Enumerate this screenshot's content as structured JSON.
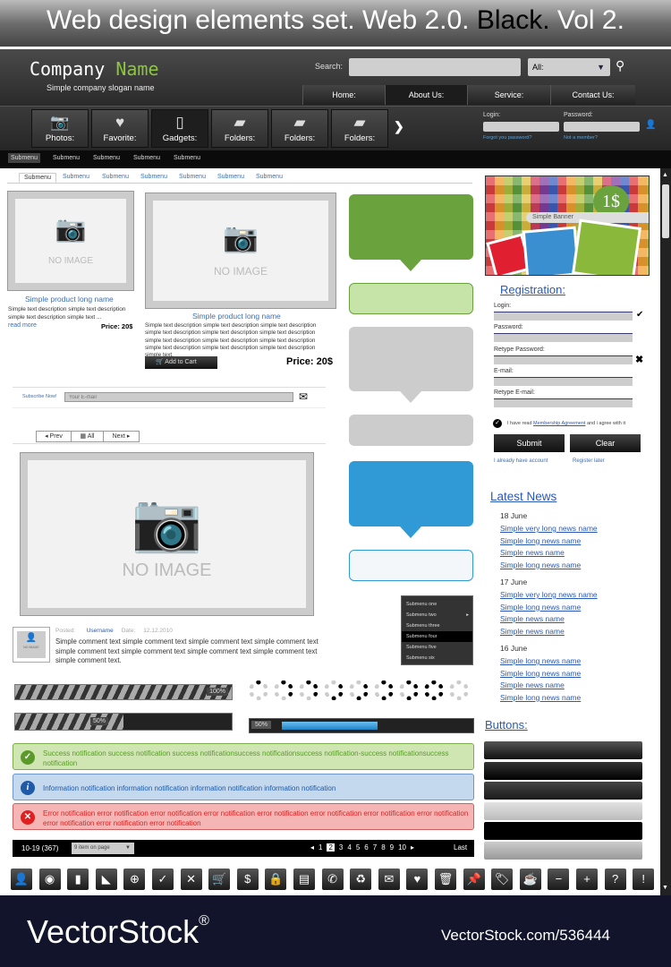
{
  "title": {
    "pre": "Web design elements set. Web 2.0. ",
    "black": "Black.",
    "post": " Vol 2."
  },
  "header": {
    "company": "Company",
    "name": "Name",
    "slogan": "Simple company slogan name",
    "search_label": "Search:",
    "search_value": "",
    "select_value": "All:",
    "nav": [
      "Home:",
      "About Us:",
      "Service:",
      "Contact Us:"
    ]
  },
  "icon_nav": [
    {
      "label": "Photos:",
      "icon": "camera-icon"
    },
    {
      "label": "Favorite:",
      "icon": "heart-icon"
    },
    {
      "label": "Gadgets:",
      "icon": "ipod-icon"
    },
    {
      "label": "Folders:",
      "icon": "folder-icon"
    },
    {
      "label": "Folders:",
      "icon": "folder-icon"
    },
    {
      "label": "Folders:",
      "icon": "folder-icon"
    }
  ],
  "login": {
    "login_label": "Login:",
    "password_label": "Password:",
    "forgot": "Forgot you password?",
    "not_member": "Not a member?"
  },
  "submenu": [
    "Submenu",
    "Submenu",
    "Submenu",
    "Submenu",
    "Submenu"
  ],
  "tabs": [
    "Submenu",
    "Submenu",
    "Submenu",
    "Submenu",
    "Submenu",
    "Submenu",
    "Submenu"
  ],
  "products": [
    {
      "name": "Simple product long name",
      "desc": "Simple text description simple text description simple text description simple text ...",
      "read_more": "read more",
      "price": "Price:  20$",
      "image": "NO IMAGE"
    },
    {
      "name": "Simple product long name",
      "desc": "Simple text description simple text description simple text description simple text  description simple text description simple text description simple text description simple text description simple text description simple text description simple text description simple text description simple text.",
      "cart": "Add to Cart",
      "price": "Price:  20$",
      "image": "NO IMAGE"
    }
  ],
  "subscribe": {
    "label": "Subscribe Now!",
    "placeholder": "Your E-mail"
  },
  "pager": {
    "prev": "Prev",
    "all": "All",
    "next": "Next"
  },
  "big_image": "NO IMAGE",
  "comment": {
    "avatar": "NO IMAGE",
    "posted": "Posted:",
    "user": "Username",
    "date_label": "Date:",
    "date": "12.12.2010",
    "text": "Simple comment text simple comment text simple comment text simple comment text simple comment text simple comment text simple comment text simple comment text simple comment text."
  },
  "progress": [
    {
      "label": "100%",
      "value": 100
    },
    {
      "label": "50%",
      "value": 50
    },
    {
      "label": "50%",
      "value": 50
    }
  ],
  "dropdown": {
    "items": [
      "Submenu one",
      "Submenu two",
      "Submenu three",
      "Submenu four",
      "Submenu five",
      "Submenu six"
    ],
    "active": 3
  },
  "notifications": {
    "success": "Success notification success notification success notificationsuccess notificationsuccess notification-success notificationsuccess notification",
    "info": "Information notification information notification information notification information notification",
    "error": "Error notification error notification error notification error notification error notification error notification error notification error notification error notification error notification error notification"
  },
  "pagination": {
    "range": "10-19 (367)",
    "per_page": "9 item on page",
    "pages": [
      "1",
      "2",
      "3",
      "4",
      "5",
      "6",
      "7",
      "8",
      "9",
      "10"
    ],
    "current": "2",
    "last": "Last"
  },
  "icons": [
    "user-icon",
    "eye-icon",
    "bar-chart-icon",
    "rss-icon",
    "globe-icon",
    "check-icon",
    "close-icon",
    "cart-icon",
    "dollar-icon",
    "lock-icon",
    "document-icon",
    "phone-icon",
    "recycle-icon",
    "mail-icon",
    "heart-icon",
    "trash-icon",
    "pin-icon",
    "tag-icon",
    "coffee-icon",
    "minus-icon",
    "plus-icon",
    "question-icon",
    "exclamation-icon"
  ],
  "banner": {
    "text": "Simple Banner",
    "price": "1$"
  },
  "registration": {
    "title": "Registration:",
    "fields": [
      "Login:",
      "Password:",
      "Retype Password:",
      "E-mail:",
      "Retype E-mail:"
    ],
    "agree_pre": "I have read ",
    "agree_link": "Membership Agreement",
    "agree_post": " and i agree with it",
    "submit": "Submit",
    "clear": "Clear",
    "have_account": "I already have account",
    "register_later": "Register later"
  },
  "news": {
    "title": "Latest News",
    "groups": [
      {
        "date": "18 June",
        "items": [
          "Simple very long news name",
          "Simple long news name",
          "Simple news name",
          "Simple long news name"
        ]
      },
      {
        "date": "17 June",
        "items": [
          "Simple very long news name",
          "Simple long news name",
          "Simple news name",
          "Simple news name"
        ]
      },
      {
        "date": "16 June",
        "items": [
          "Simple long news name",
          "Simple long news name",
          "Simple news name",
          "Simple long news name"
        ]
      }
    ]
  },
  "buttons_title": "Buttons:",
  "footer": {
    "brand": "VectorStock",
    "reg": "®",
    "url": "VectorStock.com/536444"
  },
  "colors": {
    "green": "#6aa23e",
    "blue": "#2f9ad6",
    "dark": "#2a2a2a",
    "link": "#3b6fb6"
  }
}
